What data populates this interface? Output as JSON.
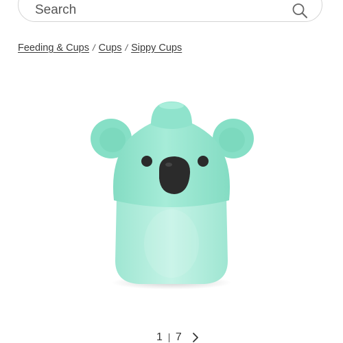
{
  "search": {
    "placeholder": "Search"
  },
  "breadcrumb": {
    "items": [
      {
        "label": "Feeding & Cups"
      },
      {
        "label": "Cups"
      },
      {
        "label": "Sippy Cups"
      }
    ],
    "separator": "/"
  },
  "product": {
    "image_icon": "koala-sippy-cup-image",
    "colors": {
      "cup_mint": "#8fe3cc",
      "cup_body_translucent": "#b6efe0",
      "nose": "#2b2b2b"
    }
  },
  "gallery": {
    "current": "1",
    "total": "7",
    "next_icon": "chevron-right-icon"
  },
  "colors": {
    "search_border": "#d4d4d4",
    "text": "#333333",
    "background": "#ffffff"
  }
}
